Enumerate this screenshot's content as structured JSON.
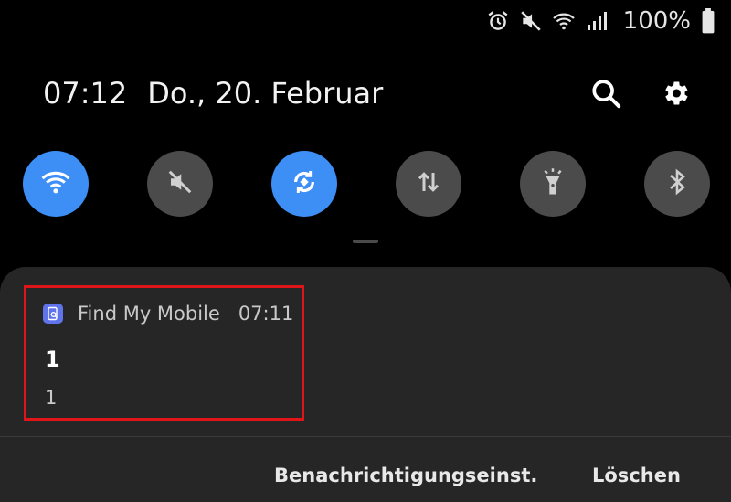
{
  "status_bar": {
    "icons": [
      "alarm-icon",
      "mute-icon",
      "wifi-icon",
      "signal-icon"
    ],
    "battery_text": "100%",
    "battery_icon": "battery-icon"
  },
  "header": {
    "time": "07:12",
    "date": "Do., 20. Februar",
    "actions": [
      "search-icon",
      "gear-icon"
    ]
  },
  "quick_toggles": [
    {
      "name": "wifi",
      "icon": "wifi-icon",
      "state": "on"
    },
    {
      "name": "sound",
      "icon": "mute-icon",
      "state": "off"
    },
    {
      "name": "auto-rotate",
      "icon": "rotate-icon",
      "state": "on"
    },
    {
      "name": "mobile-data",
      "icon": "data-transfer-icon",
      "state": "off"
    },
    {
      "name": "flashlight",
      "icon": "flashlight-icon",
      "state": "off"
    },
    {
      "name": "bluetooth",
      "icon": "bluetooth-icon",
      "state": "off"
    }
  ],
  "notification": {
    "app_icon": "find-my-mobile-icon",
    "app_name": "Find My Mobile",
    "time": "07:11",
    "title": "1",
    "body": "1"
  },
  "panel_actions": {
    "settings_label": "Benachrichtigungseinst.",
    "clear_label": "Löschen"
  },
  "colors": {
    "background": "#000000",
    "toggle_on": "#3d8ff5",
    "toggle_off": "#4b4b4b",
    "panel": "#262626",
    "highlight_border": "#e0151a",
    "app_icon": "#5f73ea"
  }
}
